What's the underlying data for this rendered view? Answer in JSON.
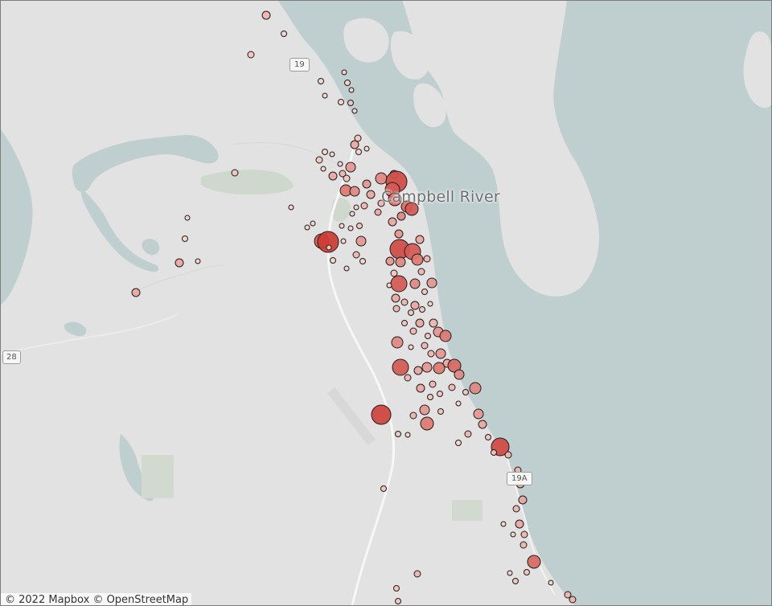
{
  "map": {
    "place_labels": {
      "city": "Campbell River"
    },
    "road_shields": {
      "hwy_19": "19",
      "hwy_28": "28",
      "hwy_19a": "19A"
    },
    "attribution": {
      "mapbox": "© 2022 Mapbox",
      "osm": "© OpenStreetMap"
    },
    "colors": {
      "water": "#bfcfd0",
      "land": "#e2e2e2",
      "park": "#cfd8cc",
      "marker_light": "#f8d2cb",
      "marker_dark": "#cc3b34",
      "marker_stroke": "#1d1d1d"
    },
    "marker_legend_note": ""
  }
}
